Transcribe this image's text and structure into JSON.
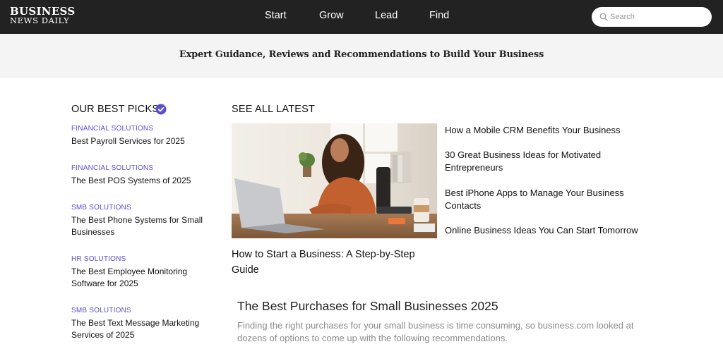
{
  "header": {
    "logo_line1": "BUSINESS",
    "logo_line2": "NEWS DAILY",
    "nav": [
      "Start",
      "Grow",
      "Lead",
      "Find"
    ],
    "search_placeholder": "Search"
  },
  "tagline": "Expert Guidance, Reviews and Recommendations to Build Your Business",
  "best_picks": {
    "title": "OUR BEST PICKS",
    "items": [
      {
        "category": "FINANCIAL SOLUTIONS",
        "title": "Best Payroll Services for 2025"
      },
      {
        "category": "FINANCIAL SOLUTIONS",
        "title": "The Best POS Systems of 2025"
      },
      {
        "category": "SMB SOLUTIONS",
        "title": "The Best Phone Systems for Small Businesses"
      },
      {
        "category": "HR SOLUTIONS",
        "title": "The Best Employee Monitoring Software for 2025"
      },
      {
        "category": "SMB SOLUTIONS",
        "title": "The Best Text Message Marketing Services of 2025"
      }
    ]
  },
  "latest": {
    "title": "SEE ALL LATEST",
    "featured_title": "How to Start a Business: A Step-by-Step Guide",
    "articles": [
      "How a Mobile CRM Benefits Your Business",
      "30 Great Business Ideas for Motivated Entrepreneurs",
      "Best iPhone Apps to Manage Your Business Contacts",
      "Online Business Ideas You Can Start Tomorrow"
    ]
  },
  "best_purchases": {
    "title": "The Best Purchases for Small Businesses 2025",
    "description": "Finding the right purchases for your small business is time consuming, so business.com looked at dozens of options to come up with the following recommendations."
  },
  "colors": {
    "header_bg": "#222222",
    "accent": "#5b4ed1",
    "band_bg": "#f4f4f5"
  }
}
